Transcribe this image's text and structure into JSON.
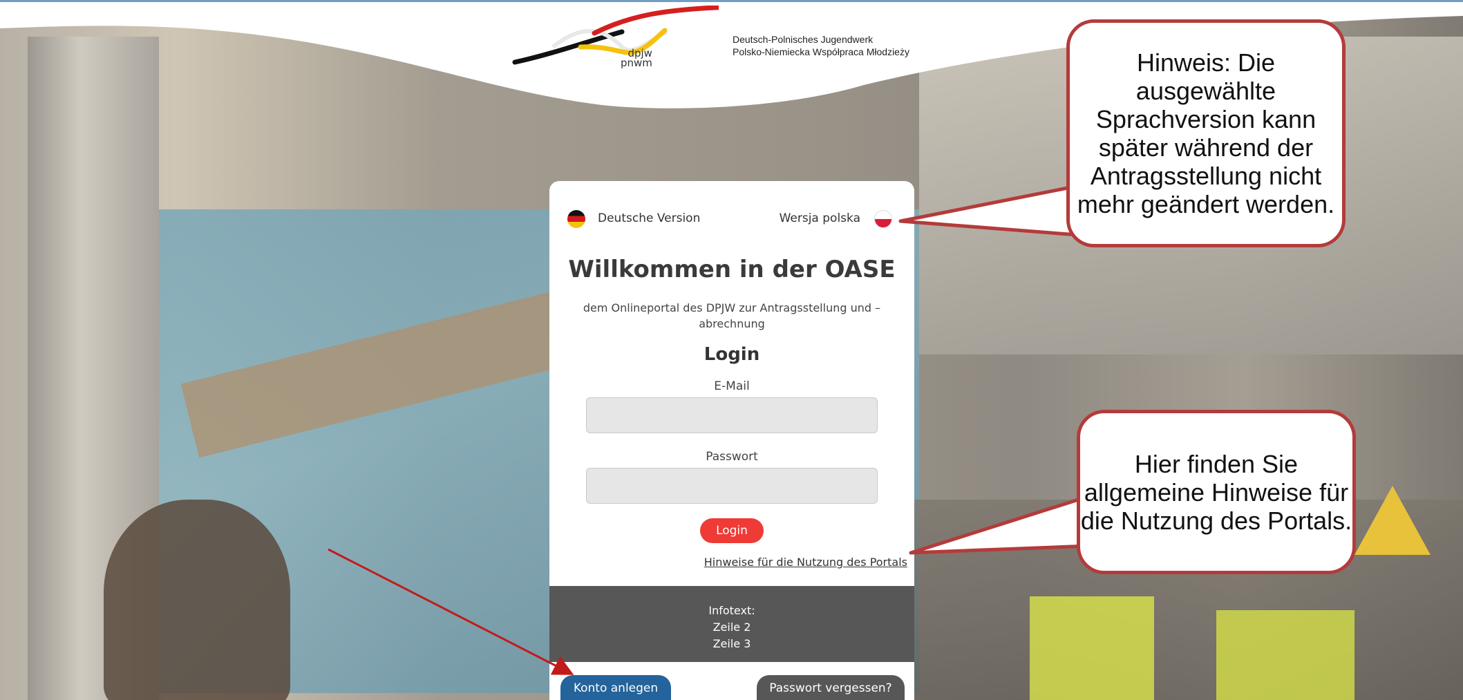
{
  "logo": {
    "abbr_de": "dpjw",
    "abbr_pl": "pnwm",
    "name_de": "Deutsch-Polnisches Jugendwerk",
    "name_pl": "Polsko-Niemiecka Współpraca Młodzieży"
  },
  "language": {
    "german_label": "Deutsche Version",
    "polish_label": "Wersja polska"
  },
  "login_card": {
    "welcome_title": "Willkommen in der OASE",
    "subtitle": "dem Onlineportal des DPJW zur Antragsstellung und –abrechnung",
    "login_heading": "Login",
    "email_label": "E-Mail",
    "email_value": "",
    "password_label": "Passwort",
    "password_value": "",
    "login_button": "Login",
    "hints_link": "Hinweise für die Nutzung des Portals",
    "info_lines": [
      "Infotext:",
      "Zeile 2",
      "Zeile 3"
    ],
    "create_account_button": "Konto anlegen",
    "forgot_password_button": "Passwort vergessen?"
  },
  "callouts": {
    "language_hint": "Hinweis: Die ausgewählte Sprachversion kann später während der Antragsstellung nicht mehr geändert werden.",
    "portal_hint": "Hier finden Sie allgemeine Hinweise für die Nutzung des Portals."
  },
  "colors": {
    "login_button": "#ef3b36",
    "create_account_button": "#24639b",
    "info_box": "#575757",
    "callout_border": "#b43b3b"
  }
}
